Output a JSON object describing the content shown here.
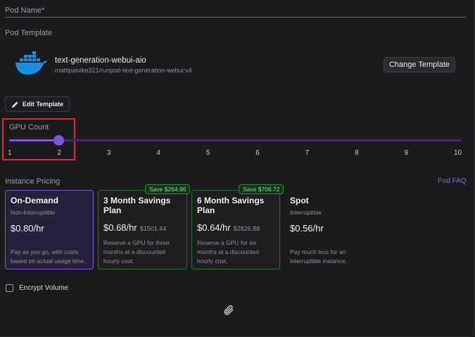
{
  "pod_name": {
    "label": "Pod Name",
    "required_mark": "*"
  },
  "pod_template": {
    "label": "Pod Template",
    "name": "text-generation-webui-aio",
    "image": "mattipaivike321/runpod-text-generation-webui:v4",
    "change_label": "Change Template",
    "edit_label": "Edit Template",
    "icon": "docker-icon"
  },
  "gpu_count": {
    "label": "GPU Count",
    "value": 2,
    "min": 1,
    "max": 10,
    "ticks": [
      "1",
      "2",
      "3",
      "4",
      "5",
      "6",
      "7",
      "8",
      "9",
      "10"
    ]
  },
  "pricing": {
    "label": "Instance Pricing",
    "faq": "Pod FAQ",
    "cards": [
      {
        "title": "On-Demand",
        "subtitle": "Non-Interruptible",
        "price": "$0.80/hr",
        "original": "",
        "description": "Pay as you go, with costs based on actual usage time.",
        "badge": "",
        "selected": true
      },
      {
        "title": "3 Month Savings Plan",
        "subtitle": "",
        "price": "$0.68/hr",
        "original": "$1501.44",
        "description": "Reserve a GPU for three months at a discounted hourly cost.",
        "badge": "Save $264.96",
        "selected": false
      },
      {
        "title": "6 Month Savings Plan",
        "subtitle": "",
        "price": "$0.64/hr",
        "original": "$2826.88",
        "description": "Reserve a GPU for six months at a discounted hourly cost.",
        "badge": "Save $706.72",
        "selected": false
      },
      {
        "title": "Spot",
        "subtitle": "Interruptible",
        "price": "$0.56/hr",
        "original": "",
        "description": "Pay much less for an interruptible instance.",
        "badge": "",
        "selected": false
      }
    ]
  },
  "encrypt_volume": {
    "label": "Encrypt Volume",
    "checked": false
  },
  "colors": {
    "accent": "#7b56d6",
    "highlight": "#e0282e",
    "save_green": "#2f8c37",
    "docker_blue": "#1d8fe0"
  }
}
